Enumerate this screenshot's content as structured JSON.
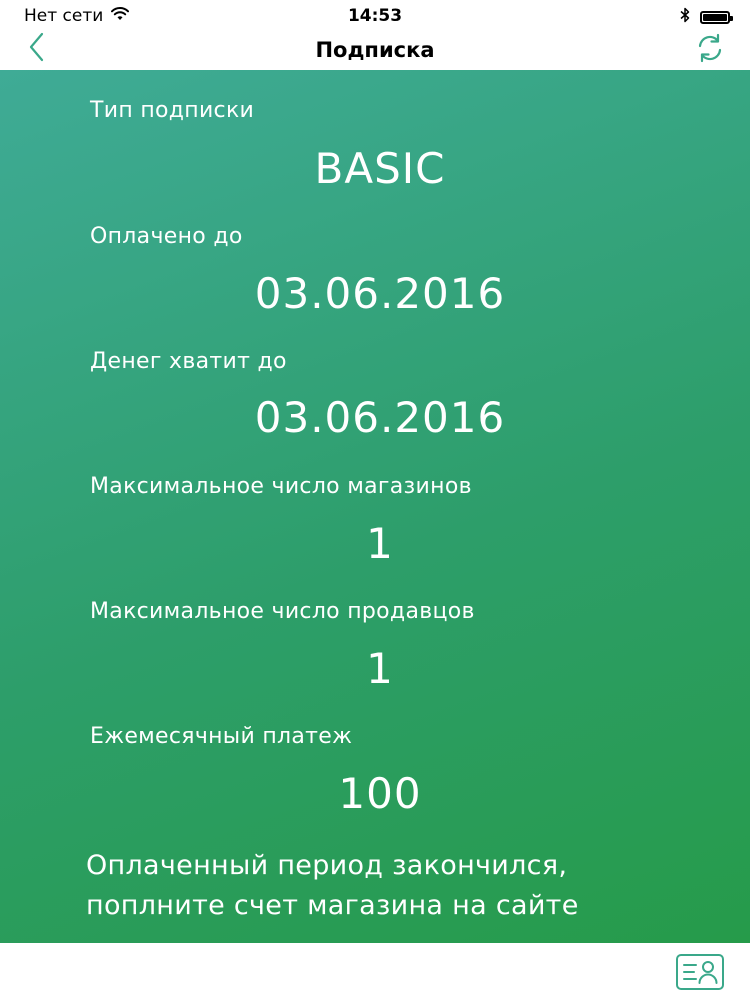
{
  "status_bar": {
    "carrier": "Нет сети",
    "time": "14:53",
    "icons": [
      "wifi-icon",
      "bluetooth-icon",
      "battery-icon"
    ]
  },
  "nav": {
    "title": "Подписка",
    "back_icon": "chevron-left-icon",
    "refresh_icon": "refresh-icon"
  },
  "subscription": {
    "type_label": "Тип подписки",
    "type_value": "BASIC",
    "paid_until_label": "Оплачено до",
    "paid_until_value": "03.06.2016",
    "money_until_label": "Денег хватит до",
    "money_until_value": "03.06.2016",
    "max_stores_label": "Максимальное число магазинов",
    "max_stores_value": "1",
    "max_sellers_label": "Максимальное число продавцов",
    "max_sellers_value": "1",
    "monthly_payment_label": "Ежемесячный платеж",
    "monthly_payment_value": "100",
    "message_line1": "Оплаченный период закончился,",
    "message_line2": "поплните счет магазина на сайте"
  },
  "bottom_bar": {
    "profile_icon": "profile-card-icon"
  },
  "colors": {
    "accent": "#3aa88a",
    "gradient_start": "#3fab96",
    "gradient_end": "#269b4a",
    "text_on_gradient": "#ffffff"
  }
}
